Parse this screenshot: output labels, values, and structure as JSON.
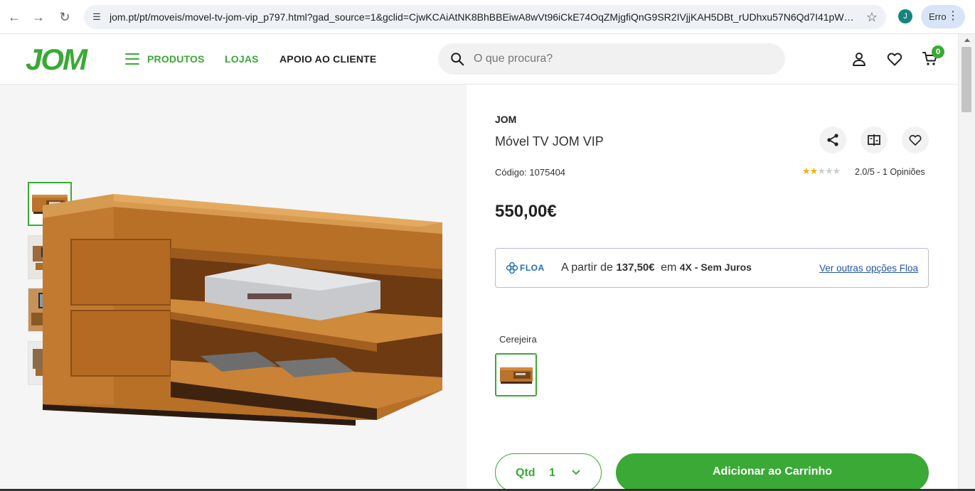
{
  "browser": {
    "url": "jom.pt/pt/moveis/movel-tv-jom-vip_p797.html?gad_source=1&gclid=CjwKCAiAtNK8BhBBEiwA8wVt96iCkE74OqZMjgfiQnG9SR2IVjjKAH5DBt_rUDhxu57N6Qd7I41pWxo...",
    "profile_initial": "J",
    "error_label": "Erro"
  },
  "header": {
    "logo": "JOM",
    "nav": [
      "PRODUTOS",
      "LOJAS",
      "APOIO AO CLIENTE"
    ],
    "search_placeholder": "O que procura?",
    "cart_count": "0",
    "accent_color": "#3aa935"
  },
  "gallery": {
    "thumbnails": [
      "thumb-1",
      "thumb-2",
      "thumb-3",
      "thumb-4"
    ],
    "active_index": 0
  },
  "product": {
    "brand": "JOM",
    "title": "Móvel TV JOM VIP",
    "code": "Código: 1075404",
    "rating": 2.0,
    "rating_text": "2.0/5 - 1 Opiniões",
    "price": "550,00€",
    "financing": {
      "provider": "FLOA",
      "prefix": "A partir de",
      "amount": "137,50€",
      "middle": "em",
      "terms": "4X - Sem Juros",
      "link": "Ver outras opções Floa"
    },
    "variant_label": "Cerejeira",
    "qty_label": "Qtd",
    "qty_value": "1",
    "add_to_cart": "Adicionar ao Carrinho"
  }
}
